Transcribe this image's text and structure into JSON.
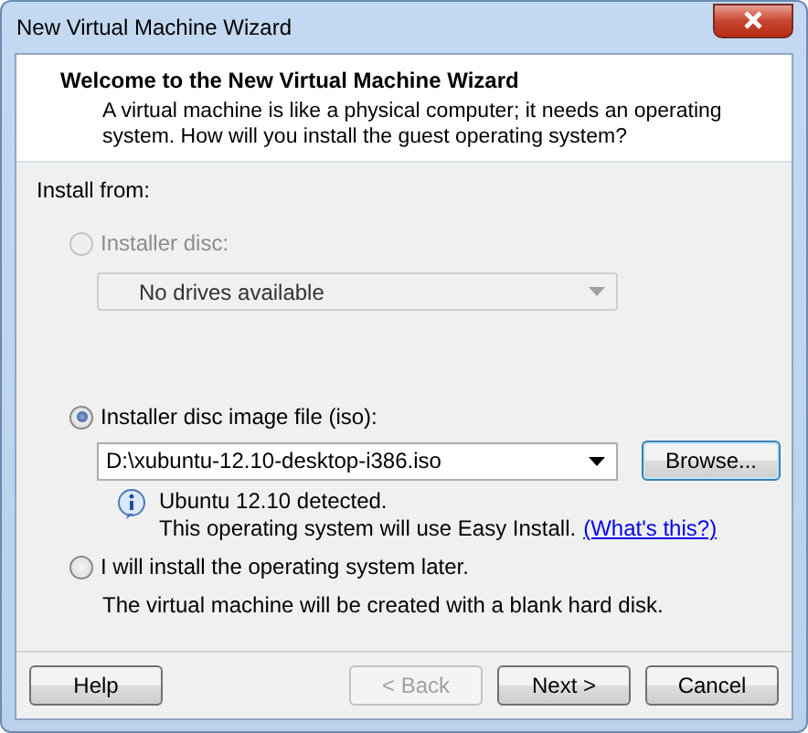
{
  "window": {
    "title": "New Virtual Machine Wizard"
  },
  "header": {
    "title": "Welcome to the New Virtual Machine Wizard",
    "description": "A virtual machine is like a physical computer; it needs an operating system. How will you install the guest operating system?"
  },
  "install_from_label": "Install from:",
  "options": [
    {
      "kind": "disc",
      "label": "Installer disc:",
      "selected": false,
      "disabled": true,
      "dropdown": {
        "value": "No drives available",
        "disabled": true
      }
    },
    {
      "kind": "image",
      "label": "Installer disc image file (iso):",
      "selected": true,
      "disabled": false,
      "file": {
        "value": "D:\\xubuntu-12.10-desktop-i386.iso",
        "browse": "Browse..."
      },
      "info": {
        "detected": "Ubuntu 12.10 detected.",
        "message": "This operating system will use Easy Install.",
        "link": "(What's this?)"
      }
    },
    {
      "kind": "later",
      "label": "I will install the operating system later.",
      "selected": false,
      "disabled": false,
      "note": "The virtual machine will be created with a blank hard disk."
    }
  ],
  "buttons": [
    {
      "label": "Help",
      "disabled": false,
      "kind": "left"
    },
    {
      "label": "< Back",
      "disabled": true,
      "kind": "right"
    },
    {
      "label": "Next >",
      "disabled": false,
      "kind": "right"
    },
    {
      "label": "Cancel",
      "disabled": false,
      "kind": "right"
    }
  ]
}
